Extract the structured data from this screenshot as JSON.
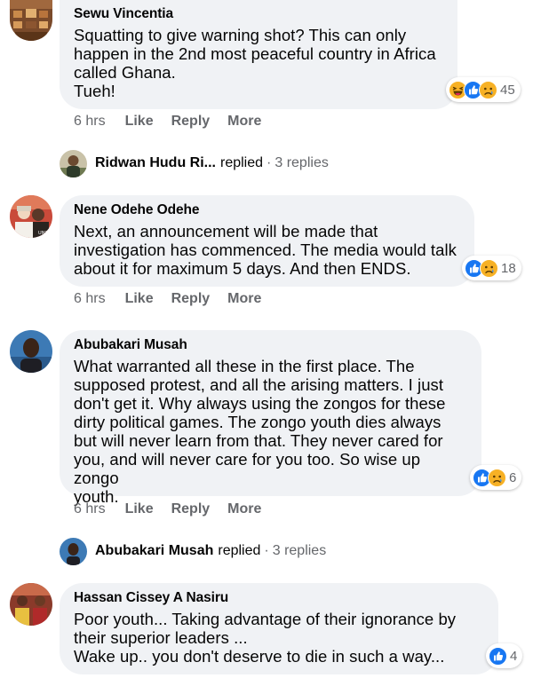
{
  "comments": [
    {
      "author": "Sewu Vincentia",
      "lines": [
        "Squatting to give warning shot? This can only",
        "happen in the 2nd most peaceful country in Africa",
        "called Ghana.",
        "Tueh!"
      ],
      "time": "6 hrs",
      "like": "Like",
      "reply": "Reply",
      "more": "More",
      "reaction_count": "45",
      "reactions": [
        "haha-icon",
        "like-icon",
        "sad-icon"
      ]
    },
    {
      "author": "Nene Odehe Odehe",
      "lines": [
        "Next, an announcement will be made that",
        "investigation has commenced. The media would talk",
        "about it for maximum 5 days. And then ENDS."
      ],
      "time": "6 hrs",
      "like": "Like",
      "reply": "Reply",
      "more": "More",
      "reaction_count": "18",
      "reactions": [
        "like-icon",
        "sad-icon"
      ]
    },
    {
      "author": "Abubakari Musah",
      "lines": [
        "What warranted all these in the first place. The",
        "supposed protest, and all the arising matters. I just",
        "don't get it. Why always using the zongos for these",
        "dirty political games. The zongo youth dies always",
        "but will never learn from that. They never cared for",
        "you, and will never care for you too. So wise up zongo",
        "youth."
      ],
      "time": "6 hrs",
      "like": "Like",
      "reply": "Reply",
      "more": "More",
      "reaction_count": "6",
      "reactions": [
        "like-icon",
        "sad-icon"
      ]
    },
    {
      "author": "Hassan Cissey A Nasiru",
      "lines": [
        "Poor youth... Taking advantage of their ignorance by",
        "their superior leaders ...",
        "Wake up.. you don't deserve to die in such a way..."
      ],
      "reaction_count": "4",
      "reactions": [
        "like-icon"
      ]
    }
  ],
  "replies": [
    {
      "name": "Ridwan Hudu Ri...",
      "verb": "replied",
      "sep": "·",
      "count": "3 replies"
    },
    {
      "name": "Abubakari Musah",
      "verb": "replied",
      "sep": "·",
      "count": "3 replies"
    }
  ],
  "colors": {
    "like": "#1877f2",
    "emoji": "#f7b125",
    "bubble": "#f0f2f5",
    "meta": "#65676b"
  }
}
